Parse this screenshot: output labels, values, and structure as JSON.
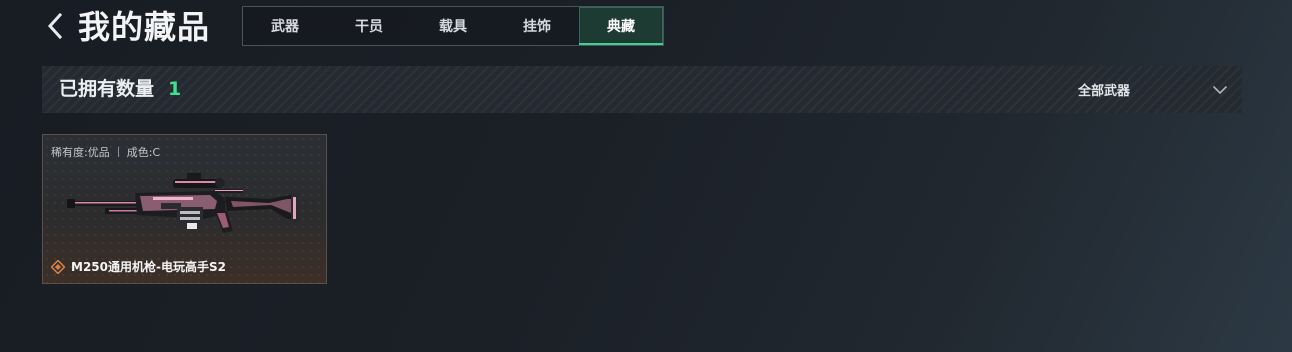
{
  "header": {
    "title": "我的藏品",
    "back_icon": "chevron-left-icon"
  },
  "tabs": [
    {
      "label": "武器",
      "active": false
    },
    {
      "label": "干员",
      "active": false
    },
    {
      "label": "载具",
      "active": false
    },
    {
      "label": "挂饰",
      "active": false
    },
    {
      "label": "典藏",
      "active": true
    }
  ],
  "count_bar": {
    "label": "已拥有数量",
    "value": "1",
    "filter": {
      "selected": "全部武器",
      "icon": "chevron-down-icon"
    }
  },
  "items": [
    {
      "rarity": "稀有度:优品",
      "condition": "成色:C",
      "name": "M250通用机枪-电玩高手S2",
      "rarity_icon": "diamond-rarity-icon"
    }
  ],
  "colors": {
    "accent_green": "#3ee08f",
    "tab_active_bg": "#1d3a33",
    "rarity_orange": "#d9824a",
    "weapon_pink": "#e58fb0"
  }
}
